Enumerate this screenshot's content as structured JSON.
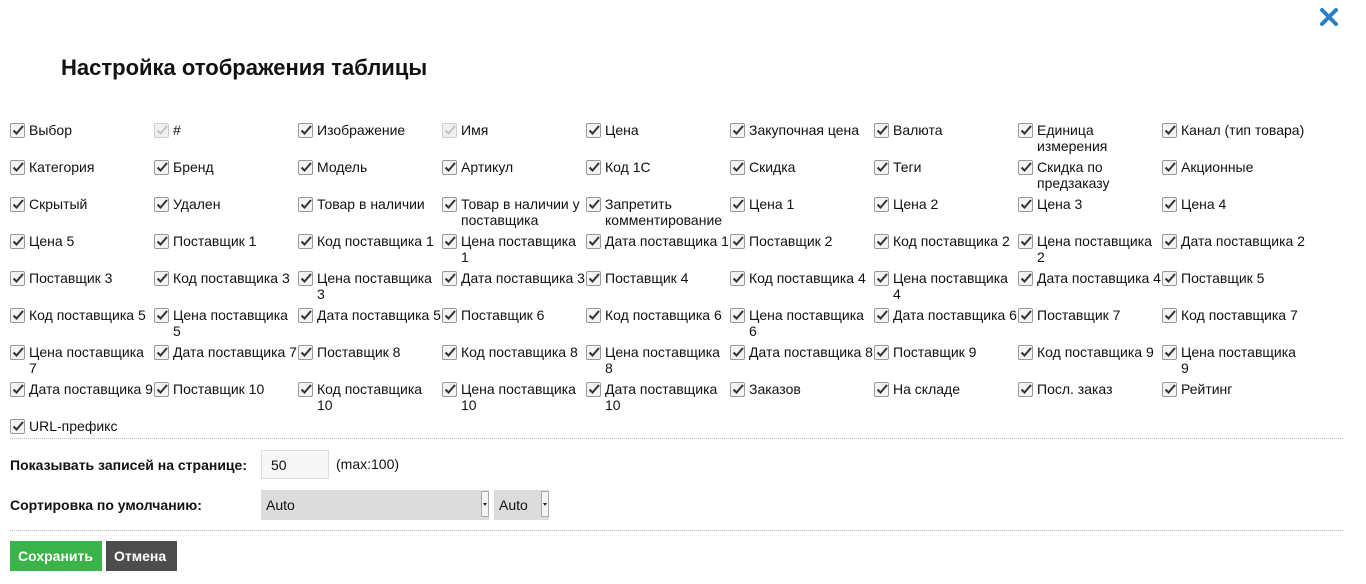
{
  "dialog": {
    "title": "Настройка отображения таблицы",
    "close_icon": "close-icon",
    "accent": "#2a7fc4"
  },
  "columns": [
    {
      "label": "Выбор",
      "checked": true,
      "disabled": false
    },
    {
      "label": "#",
      "checked": true,
      "disabled": true
    },
    {
      "label": "Изображение",
      "checked": true,
      "disabled": false
    },
    {
      "label": "Имя",
      "checked": true,
      "disabled": true
    },
    {
      "label": "Цена",
      "checked": true,
      "disabled": false
    },
    {
      "label": "Закупочная цена",
      "checked": true,
      "disabled": false
    },
    {
      "label": "Валюта",
      "checked": true,
      "disabled": false
    },
    {
      "label": "Единица измерения",
      "checked": true,
      "disabled": false
    },
    {
      "label": "Канал (тип товара)",
      "checked": true,
      "disabled": false
    },
    {
      "label": "Категория",
      "checked": true,
      "disabled": false
    },
    {
      "label": "Бренд",
      "checked": true,
      "disabled": false
    },
    {
      "label": "Модель",
      "checked": true,
      "disabled": false
    },
    {
      "label": "Артикул",
      "checked": true,
      "disabled": false
    },
    {
      "label": "Код 1С",
      "checked": true,
      "disabled": false
    },
    {
      "label": "Скидка",
      "checked": true,
      "disabled": false
    },
    {
      "label": "Теги",
      "checked": true,
      "disabled": false
    },
    {
      "label": "Скидка по предзаказу",
      "checked": true,
      "disabled": false
    },
    {
      "label": "Акционные",
      "checked": true,
      "disabled": false
    },
    {
      "label": "Скрытый",
      "checked": true,
      "disabled": false
    },
    {
      "label": "Удален",
      "checked": true,
      "disabled": false
    },
    {
      "label": "Товар в наличии",
      "checked": true,
      "disabled": false
    },
    {
      "label": "Товар в наличии у поставщика",
      "checked": true,
      "disabled": false
    },
    {
      "label": "Запретить комментирование",
      "checked": true,
      "disabled": false
    },
    {
      "label": "Цена 1",
      "checked": true,
      "disabled": false
    },
    {
      "label": "Цена 2",
      "checked": true,
      "disabled": false
    },
    {
      "label": "Цена 3",
      "checked": true,
      "disabled": false
    },
    {
      "label": "Цена 4",
      "checked": true,
      "disabled": false
    },
    {
      "label": "Цена 5",
      "checked": true,
      "disabled": false
    },
    {
      "label": "Поставщик 1",
      "checked": true,
      "disabled": false
    },
    {
      "label": "Код поставщика 1",
      "checked": true,
      "disabled": false
    },
    {
      "label": "Цена поставщика 1",
      "checked": true,
      "disabled": false
    },
    {
      "label": "Дата поставщика 1",
      "checked": true,
      "disabled": false
    },
    {
      "label": "Поставщик 2",
      "checked": true,
      "disabled": false
    },
    {
      "label": "Код поставщика 2",
      "checked": true,
      "disabled": false
    },
    {
      "label": "Цена поставщика 2",
      "checked": true,
      "disabled": false
    },
    {
      "label": "Дата поставщика 2",
      "checked": true,
      "disabled": false
    },
    {
      "label": "Поставщик 3",
      "checked": true,
      "disabled": false
    },
    {
      "label": "Код поставщика 3",
      "checked": true,
      "disabled": false
    },
    {
      "label": "Цена поставщика 3",
      "checked": true,
      "disabled": false
    },
    {
      "label": "Дата поставщика 3",
      "checked": true,
      "disabled": false
    },
    {
      "label": "Поставщик 4",
      "checked": true,
      "disabled": false
    },
    {
      "label": "Код поставщика 4",
      "checked": true,
      "disabled": false
    },
    {
      "label": "Цена поставщика 4",
      "checked": true,
      "disabled": false
    },
    {
      "label": "Дата поставщика 4",
      "checked": true,
      "disabled": false
    },
    {
      "label": "Поставщик 5",
      "checked": true,
      "disabled": false
    },
    {
      "label": "Код поставщика 5",
      "checked": true,
      "disabled": false
    },
    {
      "label": "Цена поставщика 5",
      "checked": true,
      "disabled": false
    },
    {
      "label": "Дата поставщика 5",
      "checked": true,
      "disabled": false
    },
    {
      "label": "Поставщик 6",
      "checked": true,
      "disabled": false
    },
    {
      "label": "Код поставщика 6",
      "checked": true,
      "disabled": false
    },
    {
      "label": "Цена поставщика 6",
      "checked": true,
      "disabled": false
    },
    {
      "label": "Дата поставщика 6",
      "checked": true,
      "disabled": false
    },
    {
      "label": "Поставщик 7",
      "checked": true,
      "disabled": false
    },
    {
      "label": "Код поставщика 7",
      "checked": true,
      "disabled": false
    },
    {
      "label": "Цена поставщика 7",
      "checked": true,
      "disabled": false
    },
    {
      "label": "Дата поставщика 7",
      "checked": true,
      "disabled": false
    },
    {
      "label": "Поставщик 8",
      "checked": true,
      "disabled": false
    },
    {
      "label": "Код поставщика 8",
      "checked": true,
      "disabled": false
    },
    {
      "label": "Цена поставщика 8",
      "checked": true,
      "disabled": false
    },
    {
      "label": "Дата поставщика 8",
      "checked": true,
      "disabled": false
    },
    {
      "label": "Поставщик 9",
      "checked": true,
      "disabled": false
    },
    {
      "label": "Код поставщика 9",
      "checked": true,
      "disabled": false
    },
    {
      "label": "Цена поставщика 9",
      "checked": true,
      "disabled": false
    },
    {
      "label": "Дата поставщика 9",
      "checked": true,
      "disabled": false
    },
    {
      "label": "Поставщик 10",
      "checked": true,
      "disabled": false
    },
    {
      "label": "Код поставщика 10",
      "checked": true,
      "disabled": false
    },
    {
      "label": "Цена поставщика 10",
      "checked": true,
      "disabled": false
    },
    {
      "label": "Дата поставщика 10",
      "checked": true,
      "disabled": false
    },
    {
      "label": "Заказов",
      "checked": true,
      "disabled": false
    },
    {
      "label": "На складе",
      "checked": true,
      "disabled": false
    },
    {
      "label": "Посл. заказ",
      "checked": true,
      "disabled": false
    },
    {
      "label": "Рейтинг",
      "checked": true,
      "disabled": false
    },
    {
      "label": "URL-префикс",
      "checked": true,
      "disabled": false
    }
  ],
  "per_page": {
    "label": "Показывать записей на странице:",
    "value": "50",
    "hint": "(max:100)"
  },
  "sort": {
    "label": "Сортировка по умолчанию:",
    "field": "Auto",
    "direction": "Auto"
  },
  "buttons": {
    "save": "Сохранить",
    "cancel": "Отмена",
    "save_color": "#3ab34a",
    "cancel_color": "#4d4d4d"
  }
}
